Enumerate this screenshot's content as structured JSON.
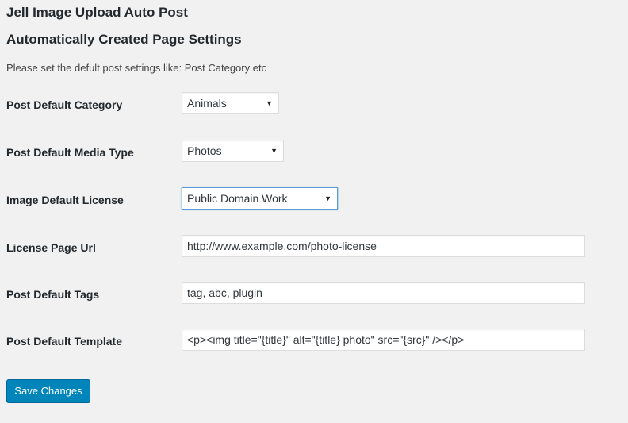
{
  "page": {
    "title": "Jell Image Upload Auto Post",
    "section_title": "Automatically Created Page Settings",
    "description": "Please set the defult post settings like: Post Category etc"
  },
  "settings": {
    "category": {
      "label": "Post Default Category",
      "selected": "Animals"
    },
    "media_type": {
      "label": "Post Default Media Type",
      "selected": "Photos"
    },
    "license": {
      "label": "Image Default License",
      "selected": "Public Domain Work"
    },
    "license_url": {
      "label": "License Page Url",
      "value": "http://www.example.com/photo-license"
    },
    "tags": {
      "label": "Post Default Tags",
      "value": "tag, abc, plugin"
    },
    "template": {
      "label": "Post Default Template",
      "value": "<p><img title=\"{title}\" alt=\"{title} photo\" src=\"{src}\" /></p>"
    }
  },
  "actions": {
    "save_label": "Save Changes"
  },
  "icons": {
    "dropdown_arrow": "▼"
  },
  "colors": {
    "primary_button": "#0085ba",
    "focus_border": "#5b9dd9",
    "background": "#f1f1f1"
  }
}
